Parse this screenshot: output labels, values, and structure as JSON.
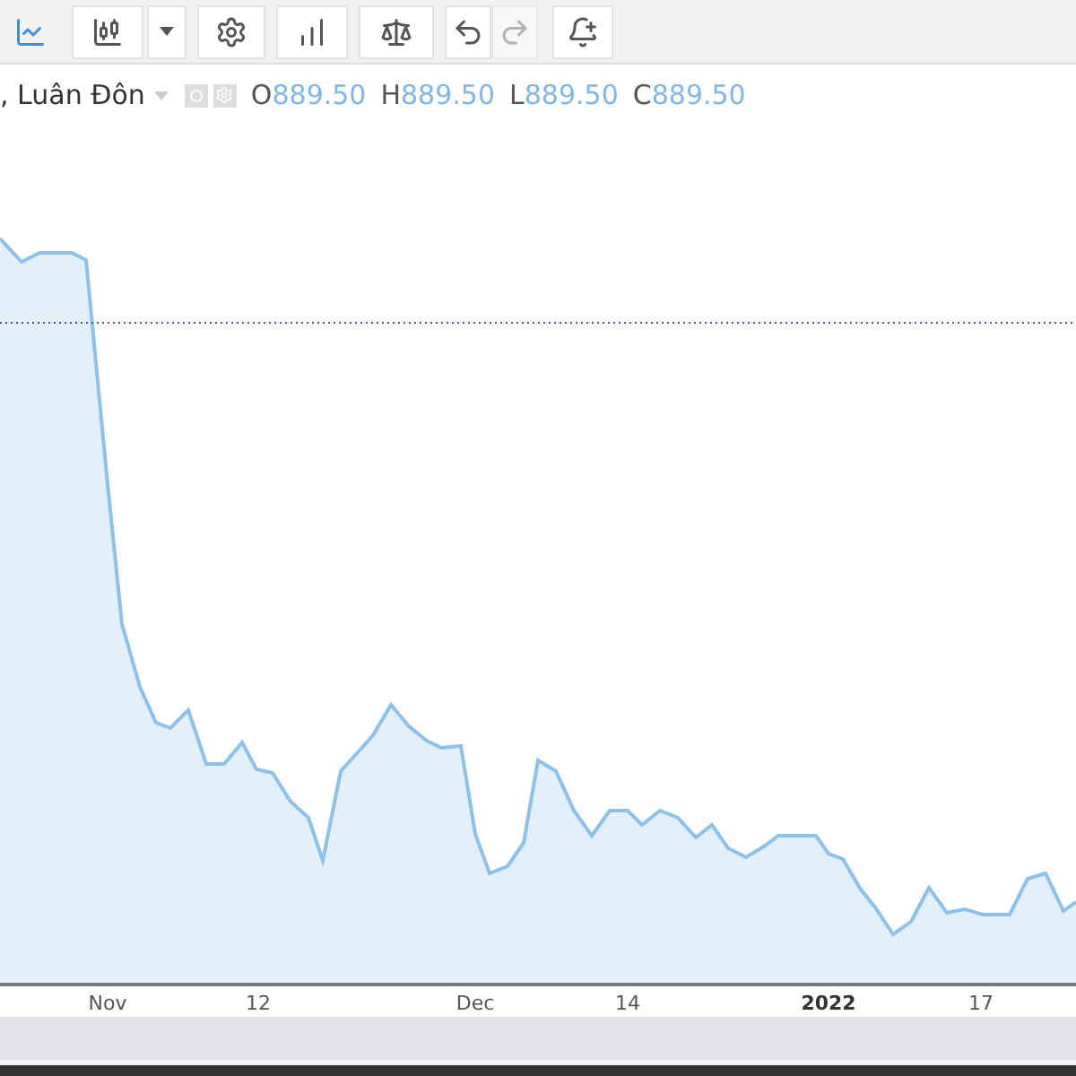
{
  "toolbar": [
    {
      "kind": "line",
      "selected": true,
      "disabled": false
    },
    {
      "kind": "candles",
      "selected": false,
      "disabled": false
    },
    {
      "kind": "dropdown",
      "selected": false,
      "disabled": false
    },
    {
      "kind": "settings",
      "selected": false,
      "disabled": false
    },
    {
      "kind": "indicators",
      "selected": false,
      "disabled": false
    },
    {
      "kind": "compare",
      "selected": false,
      "disabled": false
    },
    {
      "kind": "undo",
      "selected": false,
      "disabled": false
    },
    {
      "kind": "redo",
      "selected": false,
      "disabled": true
    },
    {
      "kind": "alert",
      "selected": false,
      "disabled": false
    }
  ],
  "legend": {
    "title": ", Luân Đôn",
    "ohlc": [
      {
        "label": "O",
        "value": "889.50"
      },
      {
        "label": "H",
        "value": "889.50"
      },
      {
        "label": "L",
        "value": "889.50"
      },
      {
        "label": "C",
        "value": "889.50"
      }
    ]
  },
  "x_axis": [
    {
      "label": "Nov",
      "kind": "month"
    },
    {
      "label": "12",
      "kind": "day"
    },
    {
      "label": "Dec",
      "kind": "month"
    },
    {
      "label": "14",
      "kind": "day"
    },
    {
      "label": "2022",
      "kind": "year"
    },
    {
      "label": "17",
      "kind": "day"
    }
  ]
}
